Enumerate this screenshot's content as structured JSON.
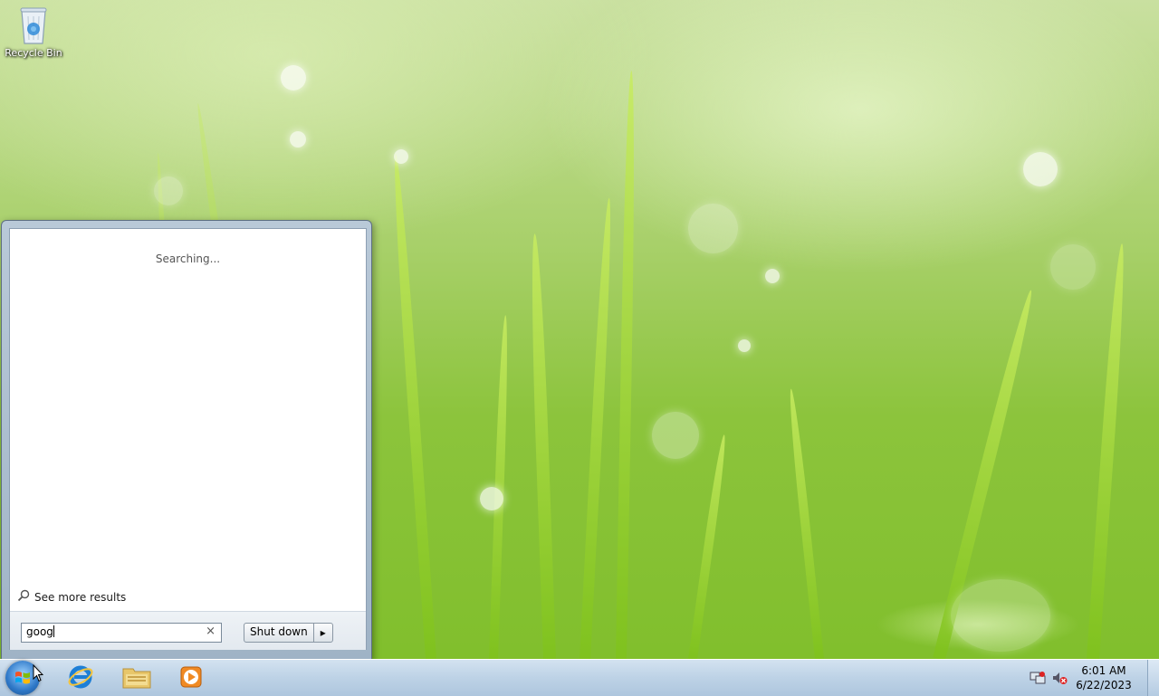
{
  "desktop": {
    "icons": [
      {
        "label": "Recycle Bin",
        "icon": "recycle-bin-icon"
      }
    ]
  },
  "start_menu": {
    "status": "Searching...",
    "see_more": "See more results",
    "search": {
      "value": "goog",
      "clear_glyph": "×"
    },
    "shutdown": {
      "label": "Shut down",
      "arrow": "▸"
    }
  },
  "taskbar": {
    "pinned": [
      {
        "name": "Internet Explorer",
        "icon": "internet-explorer-icon"
      },
      {
        "name": "Windows Explorer",
        "icon": "folder-icon"
      },
      {
        "name": "Windows Media Player",
        "icon": "media-player-icon"
      }
    ],
    "tray": {
      "icons": [
        "network-icon",
        "volume-muted-icon"
      ],
      "time": "6:01 AM",
      "date": "6/22/2023"
    }
  }
}
